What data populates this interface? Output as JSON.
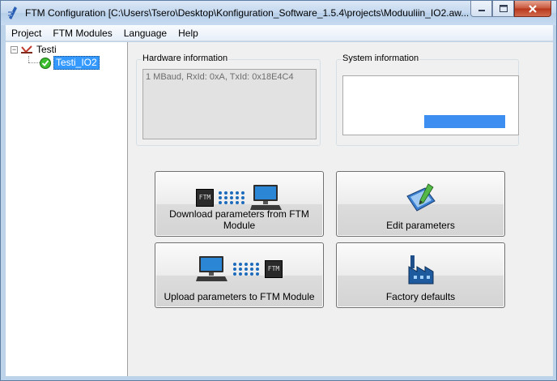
{
  "window": {
    "title": "FTM Configuration [C:\\Users\\Tsero\\Desktop\\Konfiguration_Software_1.5.4\\projects\\Moduuliin_IO2.aw..."
  },
  "menu": [
    {
      "label": "Project"
    },
    {
      "label": "FTM Modules"
    },
    {
      "label": "Language"
    },
    {
      "label": "Help"
    }
  ],
  "tree": {
    "root_label": "Testi",
    "root_toggle": "−",
    "child_label": "Testi_IO2"
  },
  "hardware_info": {
    "title": "Hardware information",
    "text": "1 MBaud, RxId: 0xA, TxId: 0x18E4C4"
  },
  "system_info": {
    "title": "System information",
    "progress_color": "#3c8ef0"
  },
  "buttons": {
    "download": {
      "label": "Download parameters from FTM Module",
      "icon": "download-from-ftm-icon"
    },
    "edit": {
      "label": "Edit parameters",
      "icon": "edit-parameters-icon"
    },
    "upload": {
      "label": "Upload parameters to FTM Module",
      "icon": "upload-to-ftm-icon"
    },
    "factory": {
      "label": "Factory defaults",
      "icon": "factory-icon"
    }
  },
  "ftm_chip_label": "FTM"
}
